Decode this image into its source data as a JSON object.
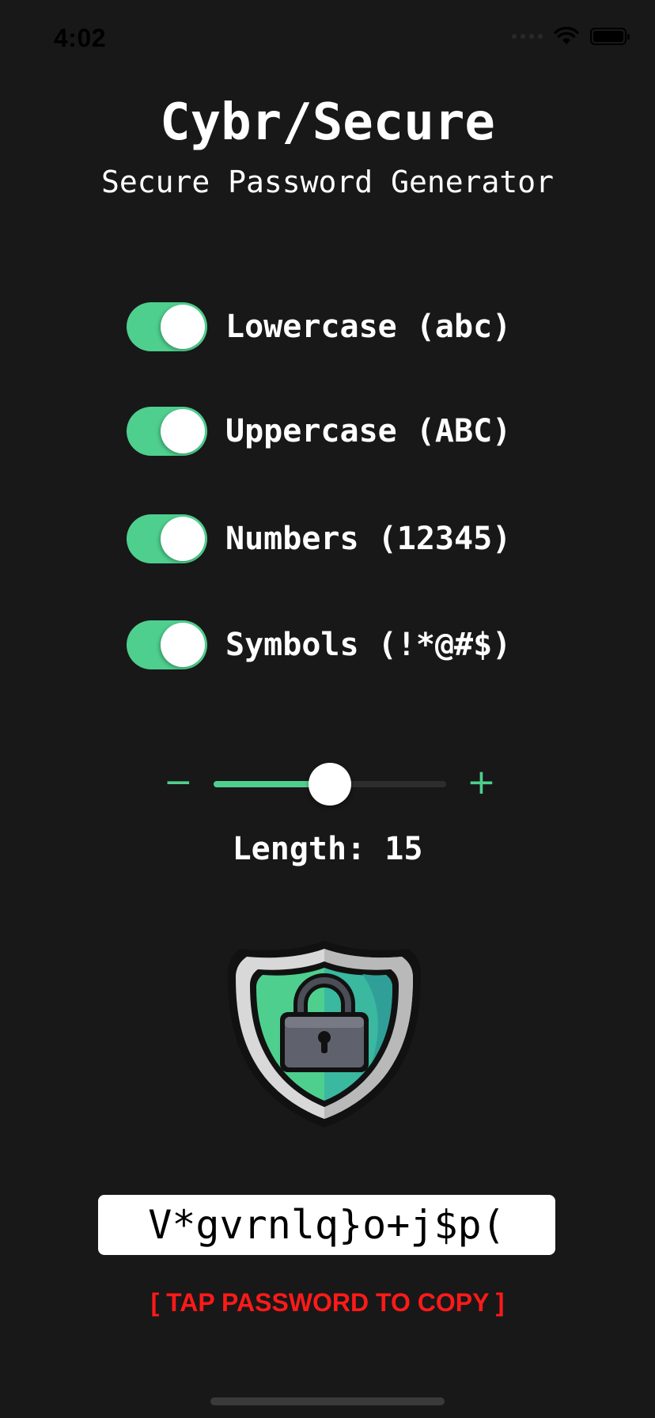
{
  "status_bar": {
    "time": "4:02"
  },
  "header": {
    "title": "Cybr/Secure",
    "subtitle": "Secure Password Generator"
  },
  "options": [
    {
      "label": "Lowercase (abc)",
      "enabled": true
    },
    {
      "label": "Uppercase (ABC)",
      "enabled": true
    },
    {
      "label": "Numbers (12345)",
      "enabled": true
    },
    {
      "label": "Symbols (!*@#$)",
      "enabled": true
    }
  ],
  "length_control": {
    "decrement_icon": "minus-icon",
    "increment_icon": "plus-icon",
    "slider_fraction": 0.5,
    "label": "Length:",
    "value": "15"
  },
  "shield": {
    "icon": "shield-lock-icon"
  },
  "password": {
    "value": "V*gvrnlq}o+j$p("
  },
  "copy_hint": "[ TAP PASSWORD TO COPY ]",
  "colors": {
    "background": "#181818",
    "accent": "#4ecf8e",
    "hint": "#ff1a1a"
  }
}
